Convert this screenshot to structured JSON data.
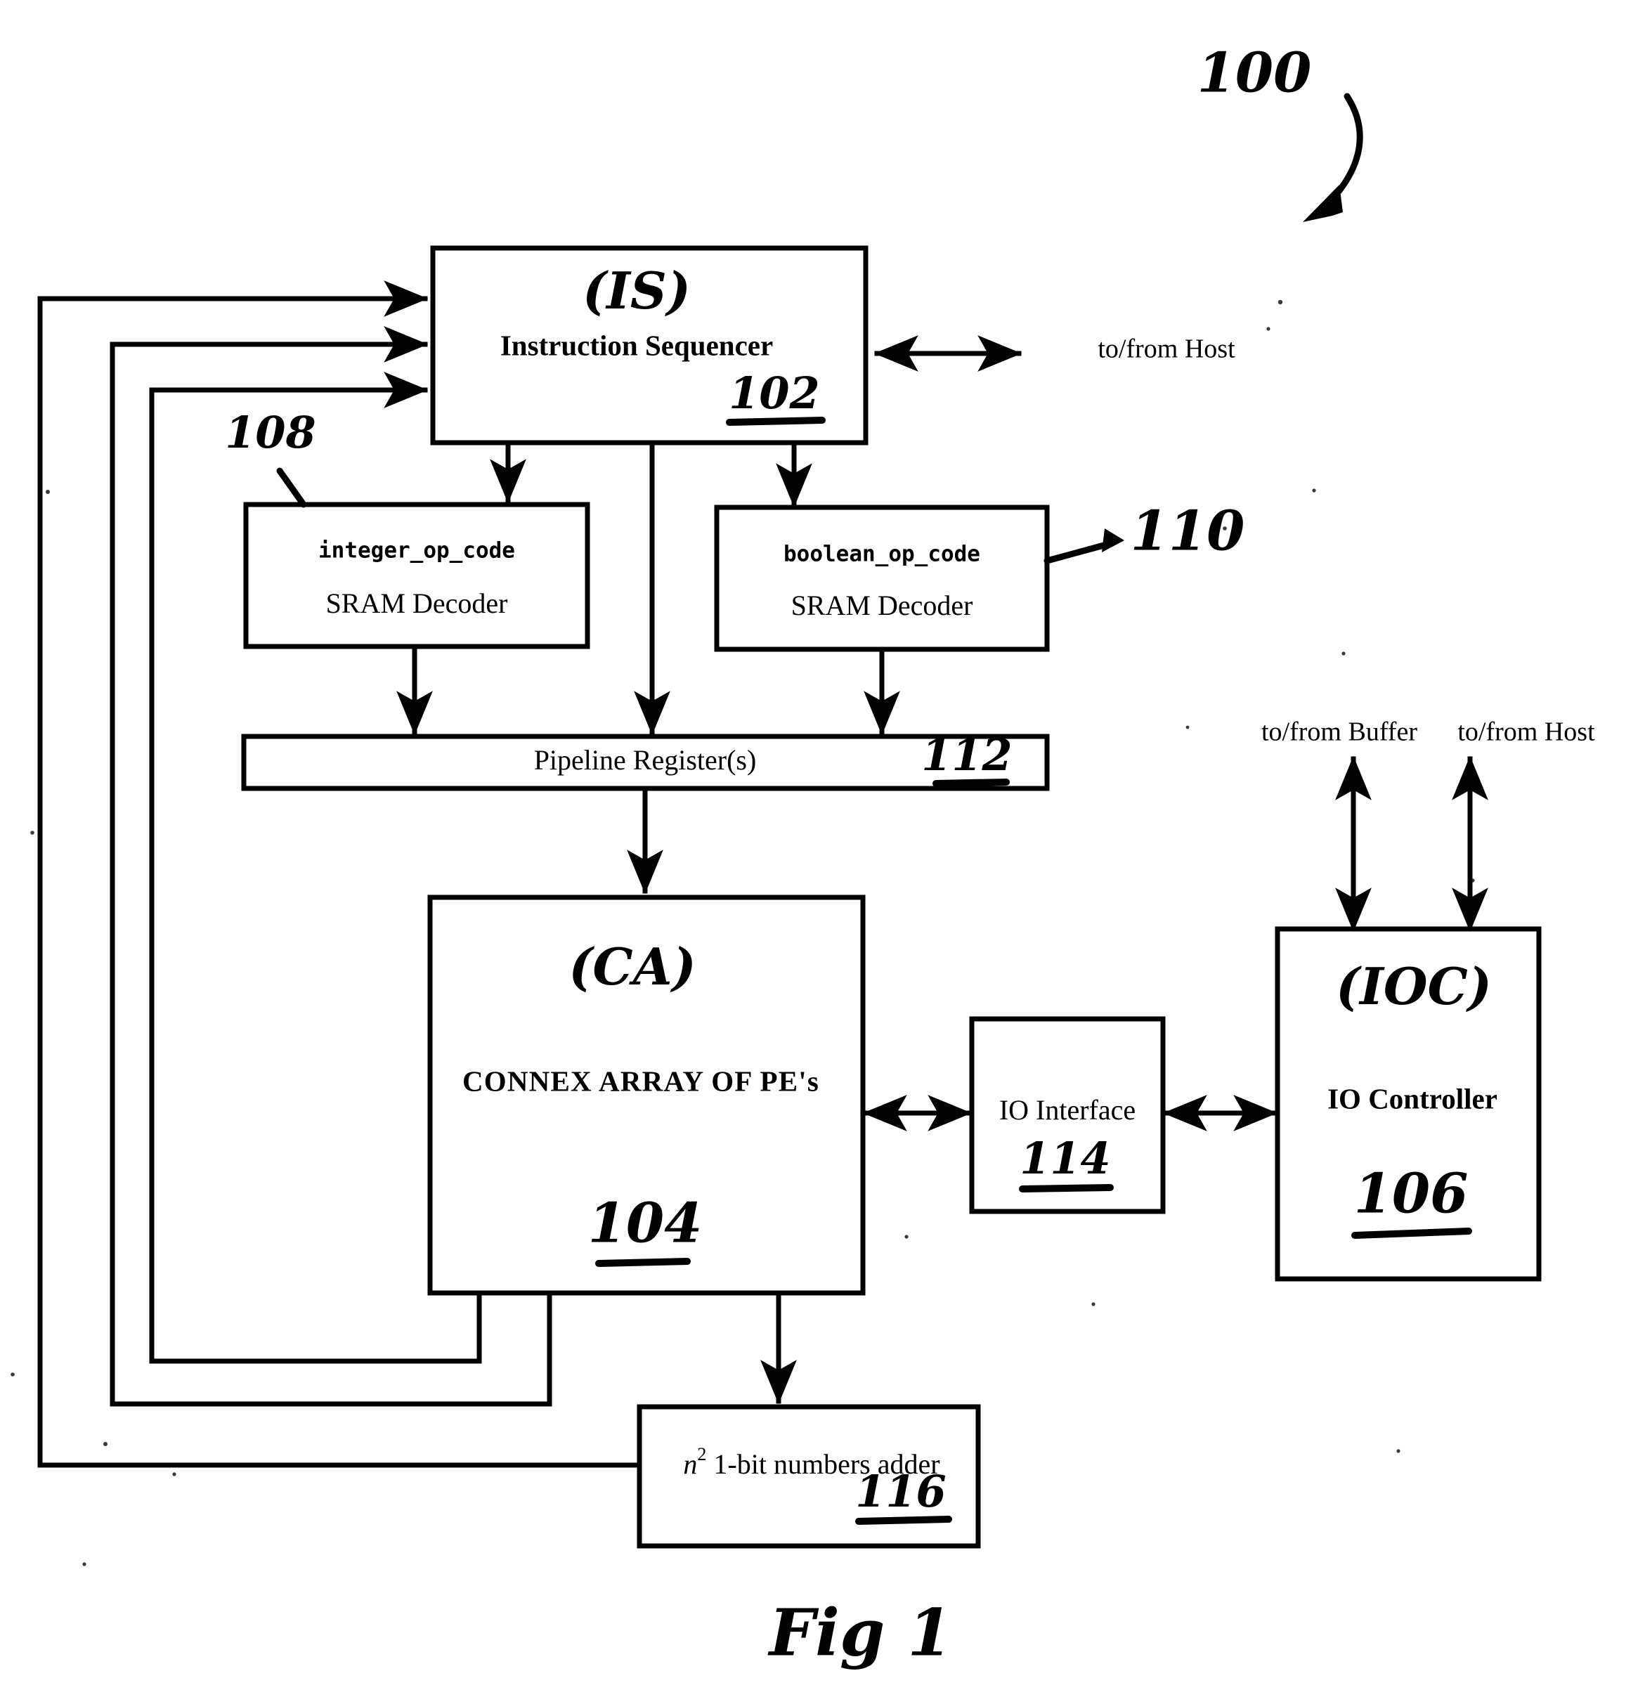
{
  "figure": {
    "caption": "Fig 1",
    "system_ref": "100"
  },
  "blocks": {
    "instruction_sequencer": {
      "abbrev": "(IS)",
      "title": "Instruction Sequencer",
      "ref": "102"
    },
    "integer_decoder": {
      "opcode": "integer_op_code",
      "title": "SRAM Decoder",
      "ref": "108"
    },
    "boolean_decoder": {
      "opcode": "boolean_op_code",
      "title": "SRAM Decoder",
      "ref": "110"
    },
    "pipeline_register": {
      "title": "Pipeline Register(s)",
      "ref": "112"
    },
    "connex_array": {
      "abbrev": "(CA)",
      "title": "CONNEX ARRAY OF PE's",
      "ref": "104"
    },
    "io_interface": {
      "title": "IO Interface",
      "ref": "114"
    },
    "io_controller": {
      "abbrev": "(IOC)",
      "title": "IO Controller",
      "ref": "106"
    },
    "adder": {
      "title_pre": "n",
      "title_sup": "2",
      "title_post": "1-bit numbers adder",
      "ref": "116"
    }
  },
  "external_labels": {
    "host_top": "to/from Host",
    "buffer_ioc": "to/from Buffer",
    "host_ioc": "to/from Host"
  },
  "colors": {
    "ink": "#000000",
    "paper": "#ffffff"
  }
}
